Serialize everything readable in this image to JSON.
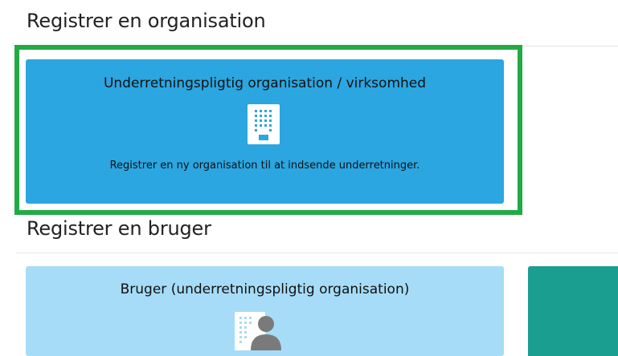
{
  "sections": {
    "organisation": {
      "title": "Registrer en organisation",
      "card": {
        "title": "Underretningspligtig organisation / virksomhed",
        "description": "Registrer en ny organisation til at indsende underretninger.",
        "icon": "building-icon",
        "color": "#2ba6e0"
      }
    },
    "user": {
      "title": "Registrer en bruger",
      "card": {
        "title": "Bruger (underretningspligtig organisation)",
        "icon": "user-building-icon",
        "color": "#a6dcf7"
      },
      "third_card_color": "#1a9e8f"
    }
  },
  "highlight_color": "#22ab45"
}
